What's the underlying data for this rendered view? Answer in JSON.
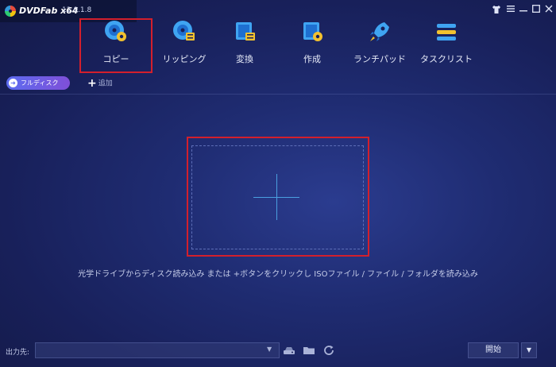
{
  "app": {
    "name": "DVDFab x64",
    "version": "12.0.1.8"
  },
  "window_controls": [
    {
      "name": "tshirt-icon",
      "glyph": "👕"
    },
    {
      "name": "menu-icon",
      "glyph": "≡"
    },
    {
      "name": "minimize-icon",
      "glyph": "—"
    },
    {
      "name": "maximize-icon",
      "glyph": "☐"
    },
    {
      "name": "close-icon",
      "glyph": "✕"
    }
  ],
  "nav": {
    "items": [
      {
        "label": "コピー",
        "icon": "disc-copy-icon",
        "selected": true
      },
      {
        "label": "リッピング",
        "icon": "disc-rip-icon"
      },
      {
        "label": "変換",
        "icon": "film-convert-icon"
      },
      {
        "label": "作成",
        "icon": "film-create-icon"
      },
      {
        "label": "ランチパッド",
        "icon": "rocket-icon"
      },
      {
        "label": "タスクリスト",
        "icon": "task-list-icon"
      }
    ]
  },
  "mode_button": {
    "label": "フルディスク",
    "icon": "circle-arrow-icon"
  },
  "add_button": {
    "label": "追加",
    "icon": "plus-icon"
  },
  "drop_zone": {
    "hint": "光学ドライブからディスク読み込み または +ボタンをクリックし ISOファイル / ファイル / フォルダを読み込み"
  },
  "output": {
    "label": "出力先:",
    "value": "",
    "icons": [
      "dropdown-arrow-icon",
      "iso-drive-icon",
      "folder-icon",
      "refresh-icon"
    ]
  },
  "start_button": {
    "label": "開始"
  },
  "colors": {
    "accent": "#5c6cf0",
    "highlight": "#d31f2c",
    "plus": "#4a9fe0"
  }
}
